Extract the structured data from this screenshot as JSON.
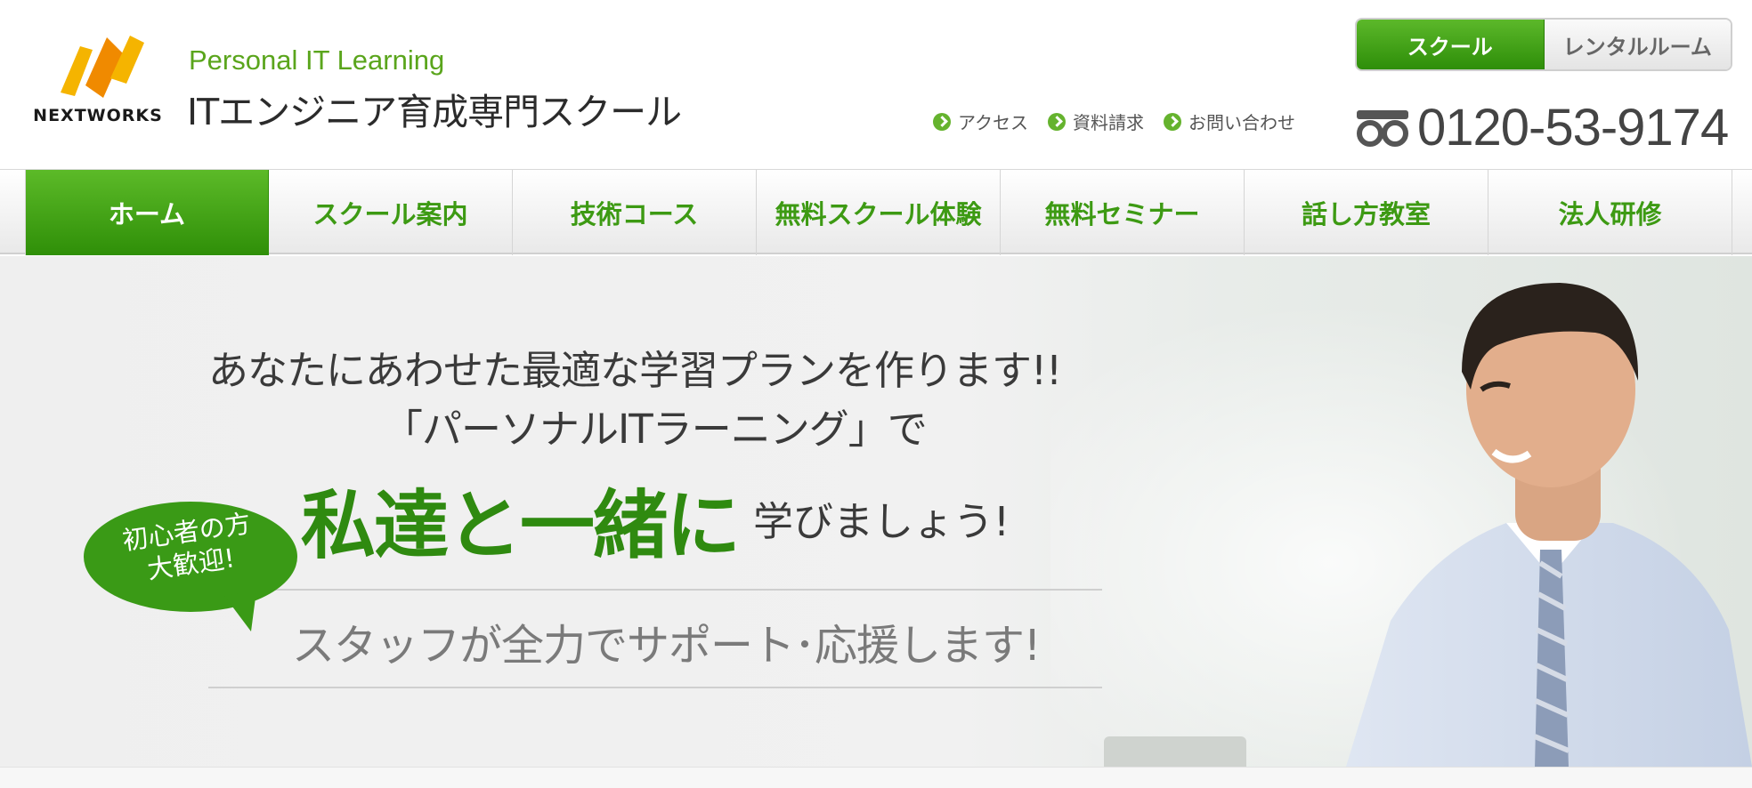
{
  "brand": {
    "logo_word": "NEXTWORKS",
    "tagline": "Personal IT Learning",
    "school_title": "ITエンジニア育成専門スクール",
    "accent_color": "#3d9a13",
    "logo_colors": [
      "#f5b400",
      "#f08a00"
    ]
  },
  "switcher": {
    "school_label": "スクール",
    "rental_label": "レンタルルーム",
    "active": "school"
  },
  "utility_links": [
    {
      "label": "アクセス",
      "icon": "chevron-right-icon"
    },
    {
      "label": "資料請求",
      "icon": "chevron-right-icon"
    },
    {
      "label": "お問い合わせ",
      "icon": "chevron-right-icon"
    }
  ],
  "phone": {
    "icon": "freedial-icon",
    "number": "0120-53-9174"
  },
  "nav": {
    "items": [
      {
        "label": "ホーム",
        "active": true
      },
      {
        "label": "スクール案内",
        "active": false
      },
      {
        "label": "技術コース",
        "active": false
      },
      {
        "label": "無料スクール体験",
        "active": false
      },
      {
        "label": "無料セミナー",
        "active": false
      },
      {
        "label": "話し方教室",
        "active": false
      },
      {
        "label": "法人研修",
        "active": false
      }
    ]
  },
  "hero": {
    "line1": "あなたにあわせた最適な学習プランを作ります!!",
    "line2": "「パーソナルITラーニング」で",
    "headline": "私達と一緒に",
    "headline_suffix": "学びましょう!",
    "support": "スタッフが全力でサポート･応援します!",
    "bubble_line1": "初心者の方",
    "bubble_line2": "大歓迎!",
    "bubble_color": "#3a9a16"
  }
}
